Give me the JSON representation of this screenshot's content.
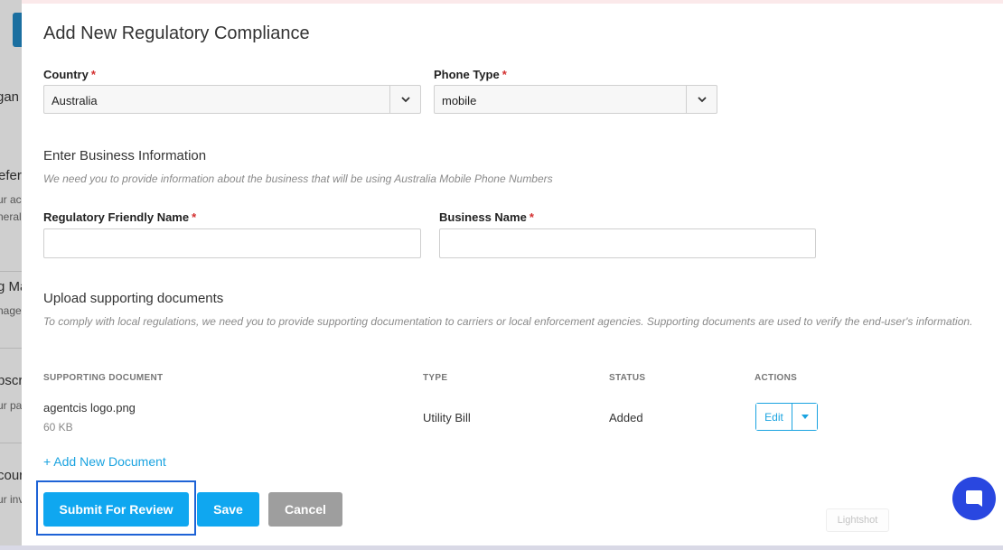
{
  "background": {
    "fragments": [
      {
        "text": "gan",
        "type": "title"
      },
      {
        "text": "eferi",
        "type": "title"
      },
      {
        "text": "ur ac",
        "type": "sub"
      },
      {
        "text": "neral",
        "type": "sub"
      },
      {
        "text": "g Ma",
        "type": "title"
      },
      {
        "text": "nage",
        "type": "sub"
      },
      {
        "text": "bscri",
        "type": "title"
      },
      {
        "text": "ur pa",
        "type": "sub"
      },
      {
        "text": "cour",
        "type": "title"
      },
      {
        "text": "ur inv",
        "type": "sub"
      }
    ]
  },
  "modal": {
    "title": "Add New Regulatory Compliance",
    "country": {
      "label": "Country",
      "required_mark": "*",
      "value": "Australia"
    },
    "phone_type": {
      "label": "Phone Type",
      "required_mark": "*",
      "value": "mobile"
    },
    "business_info": {
      "heading": "Enter Business Information",
      "hint": "We need you to provide information about the business that will be using Australia Mobile Phone Numbers",
      "friendly_name": {
        "label": "Regulatory Friendly Name",
        "required_mark": "*",
        "value": "",
        "placeholder": ""
      },
      "business_name": {
        "label": "Business Name",
        "required_mark": "*",
        "value": "",
        "placeholder": ""
      }
    },
    "documents": {
      "heading": "Upload supporting documents",
      "hint": "To comply with local regulations, we need you to provide supporting documentation to carriers or local enforcement agencies. Supporting documents are used to verify the end-user's information.",
      "columns": [
        "SUPPORTING DOCUMENT",
        "TYPE",
        "STATUS",
        "ACTIONS"
      ],
      "rows": [
        {
          "name": "agentcis logo.png",
          "size": "60 KB",
          "type": "Utility Bill",
          "status": "Added",
          "action": "Edit"
        }
      ],
      "add_link": "+ Add New Document"
    },
    "buttons": {
      "submit": "Submit For Review",
      "save": "Save",
      "cancel": "Cancel"
    }
  },
  "overlay": {
    "lightshot": "Lightshot",
    "chat_icon": "chat-bubble-icon"
  },
  "colors": {
    "accent": "#0fa7f0",
    "required": "#d32f2f",
    "chat": "#2947e0",
    "focus": "#1e63d6",
    "cancel": "#9e9e9e"
  }
}
